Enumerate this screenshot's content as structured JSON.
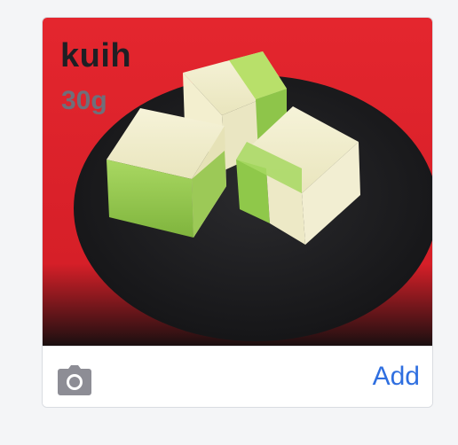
{
  "card": {
    "title": "kuih",
    "weight": "30g",
    "image_subject": "kuih-photo"
  },
  "footer": {
    "camera_icon": "camera-icon",
    "add_label": "Add"
  },
  "colors": {
    "background": "#f4f5f7",
    "accent": "#2f6fe0",
    "title": "#1f1f24",
    "weight": "#6f6f7a",
    "camera": "#8d8d95"
  }
}
